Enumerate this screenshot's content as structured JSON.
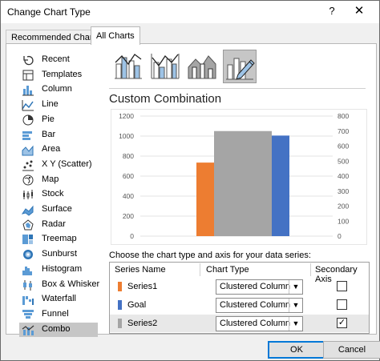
{
  "window": {
    "title": "Change Chart Type",
    "help": "?",
    "close": "✕"
  },
  "tabs": [
    {
      "label": "Recommended Charts",
      "active": false
    },
    {
      "label": "All Charts",
      "active": true
    }
  ],
  "sidebar": {
    "items": [
      {
        "label": "Recent",
        "icon": "recent-icon"
      },
      {
        "label": "Templates",
        "icon": "templates-icon"
      },
      {
        "label": "Column",
        "icon": "column-chart-icon"
      },
      {
        "label": "Line",
        "icon": "line-chart-icon"
      },
      {
        "label": "Pie",
        "icon": "pie-chart-icon"
      },
      {
        "label": "Bar",
        "icon": "bar-chart-icon"
      },
      {
        "label": "Area",
        "icon": "area-chart-icon"
      },
      {
        "label": "X Y (Scatter)",
        "icon": "scatter-chart-icon"
      },
      {
        "label": "Map",
        "icon": "map-chart-icon"
      },
      {
        "label": "Stock",
        "icon": "stock-chart-icon"
      },
      {
        "label": "Surface",
        "icon": "surface-chart-icon"
      },
      {
        "label": "Radar",
        "icon": "radar-chart-icon"
      },
      {
        "label": "Treemap",
        "icon": "treemap-chart-icon"
      },
      {
        "label": "Sunburst",
        "icon": "sunburst-chart-icon"
      },
      {
        "label": "Histogram",
        "icon": "histogram-chart-icon"
      },
      {
        "label": "Box & Whisker",
        "icon": "box-whisker-chart-icon"
      },
      {
        "label": "Waterfall",
        "icon": "waterfall-chart-icon"
      },
      {
        "label": "Funnel",
        "icon": "funnel-chart-icon"
      },
      {
        "label": "Combo",
        "icon": "combo-chart-icon",
        "selected": true
      }
    ]
  },
  "subtypes": [
    {
      "name": "clustered-column-line",
      "selected": false
    },
    {
      "name": "clustered-column-line-secondary-axis",
      "selected": false
    },
    {
      "name": "stacked-area-clustered-column",
      "selected": false
    },
    {
      "name": "custom-combination",
      "selected": true
    }
  ],
  "main": {
    "heading": "Custom Combination",
    "instructions": "Choose the chart type and axis for your data series:"
  },
  "colors": {
    "series1": "#ed7d31",
    "goal": "#4472c4",
    "series2": "#a5a5a5",
    "accent": "#0078d7"
  },
  "chart_data": {
    "type": "bar",
    "y_left_ticks": [
      "0",
      "200",
      "400",
      "600",
      "800",
      "1000",
      "1200"
    ],
    "y_right_ticks": [
      "0",
      "100",
      "200",
      "300",
      "400",
      "500",
      "600",
      "700",
      "800"
    ],
    "ylim_left": [
      0,
      1200
    ],
    "ylim_right": [
      0,
      800
    ],
    "grid": true,
    "series": [
      {
        "name": "Series1",
        "value": 490,
        "axis": "secondary",
        "color": "#ed7d31"
      },
      {
        "name": "Series2",
        "value": 1050,
        "axis": "primary",
        "color": "#a5a5a5"
      },
      {
        "name": "Goal",
        "value": 670,
        "axis": "secondary",
        "color": "#4472c4"
      }
    ]
  },
  "series_table": {
    "headers": {
      "name": "Series Name",
      "type": "Chart Type",
      "axis": "Secondary Axis"
    },
    "rows": [
      {
        "name": "Series1",
        "type": "Clustered Column",
        "secondary": false,
        "color": "#ed7d31"
      },
      {
        "name": "Goal",
        "type": "Clustered Column",
        "secondary": false,
        "color": "#4472c4"
      },
      {
        "name": "Series2",
        "type": "Clustered Column",
        "secondary": true,
        "color": "#a5a5a5"
      }
    ]
  },
  "buttons": {
    "ok": "OK",
    "cancel": "Cancel"
  }
}
